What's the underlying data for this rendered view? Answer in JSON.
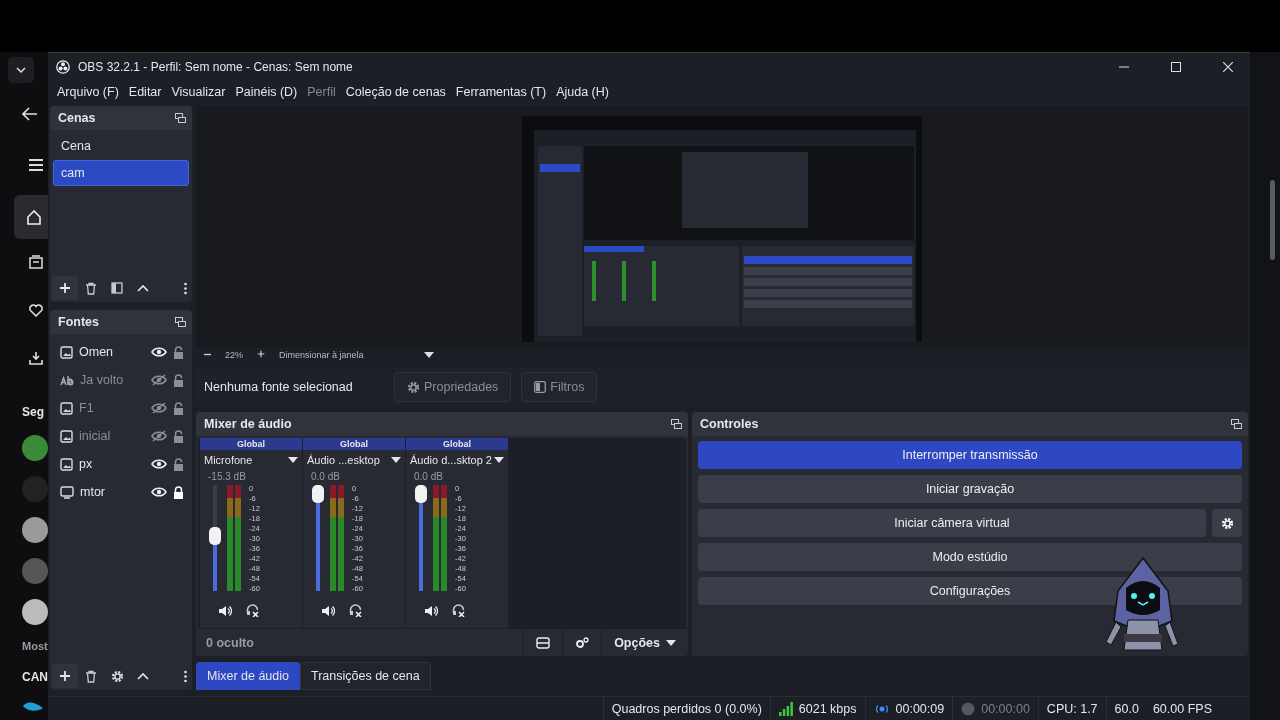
{
  "browser_sidebar": {
    "section_heading": "Seg",
    "more_link": "Most",
    "channel_heading": "CAN"
  },
  "window": {
    "title": "OBS 32.2.1 - Perfil: Sem nome - Cenas: Sem nome"
  },
  "menu": [
    {
      "label": "Arquivo (F)",
      "disabled": false
    },
    {
      "label": "Editar",
      "disabled": false
    },
    {
      "label": "Visualizar",
      "disabled": false
    },
    {
      "label": "Painéis (D)",
      "disabled": false
    },
    {
      "label": "Perfil",
      "disabled": true
    },
    {
      "label": "Coleção de cenas",
      "disabled": false
    },
    {
      "label": "Ferramentas (T)",
      "disabled": false
    },
    {
      "label": "Ajuda (H)",
      "disabled": false
    }
  ],
  "scenes": {
    "title": "Cenas",
    "items": [
      {
        "label": "Cena",
        "selected": false
      },
      {
        "label": "cam",
        "selected": true
      }
    ]
  },
  "sources": {
    "title": "Fontes",
    "items": [
      {
        "kind": "image",
        "label": "Omen",
        "visible": true,
        "locked": false
      },
      {
        "kind": "text",
        "label": "Ja volto",
        "visible": false,
        "locked": false
      },
      {
        "kind": "image",
        "label": "F1",
        "visible": false,
        "locked": false
      },
      {
        "kind": "image",
        "label": "inicial",
        "visible": false,
        "locked": false
      },
      {
        "kind": "image",
        "label": "px",
        "visible": true,
        "locked": false
      },
      {
        "kind": "display",
        "label": "mtor",
        "visible": true,
        "locked": true
      }
    ]
  },
  "preview": {
    "zoom": "22%",
    "scale_mode": "Dimensionar à janela"
  },
  "source_bar": {
    "status": "Nenhuma fonte selecionad",
    "buttons": [
      {
        "kind": "properties",
        "label": "Propriedades",
        "disabled": true
      },
      {
        "kind": "filters",
        "label": "Filtros",
        "disabled": true
      }
    ]
  },
  "mixer": {
    "title": "Mixer de áudio",
    "channels": [
      {
        "tag": "Global",
        "name": "Microfone",
        "reading": "-15.3 dB",
        "level": 0.52,
        "scale": [
          "0",
          "-6",
          "-12",
          "-18",
          "-24",
          "-30",
          "-36",
          "-42",
          "-48",
          "-54",
          "-60"
        ]
      },
      {
        "tag": "Global",
        "name": "Áudio ...esktop",
        "reading": "0.0 dB",
        "level": 1,
        "scale": [
          "0",
          "-6",
          "-12",
          "-18",
          "-24",
          "-30",
          "-36",
          "-42",
          "-48",
          "-54",
          "-60"
        ]
      },
      {
        "tag": "Global",
        "name": "Áudio d...sktop 2",
        "reading": "0.0 dB",
        "level": 1,
        "scale": [
          "0",
          "-6",
          "-12",
          "-18",
          "-24",
          "-30",
          "-36",
          "-42",
          "-48",
          "-54",
          "-60"
        ]
      }
    ],
    "hidden_count": "0 oculto",
    "options": "Opções"
  },
  "controls": {
    "title": "Controles",
    "buttons": [
      {
        "label": "Interromper transmissão",
        "active": true,
        "settings": false
      },
      {
        "label": "Iniciar gravação",
        "active": false,
        "settings": false
      },
      {
        "label": "Iniciar câmera virtual",
        "active": false,
        "settings": true
      },
      {
        "label": "Modo estúdio",
        "active": false,
        "settings": false
      },
      {
        "label": "Configurações",
        "active": false,
        "settings": false
      }
    ]
  },
  "dock_tabs": [
    {
      "label": "Mixer de áudio",
      "selected": true
    },
    {
      "label": "Transições de cena",
      "selected": false
    }
  ],
  "status_bar": {
    "dropped": "Quadros perdidos 0 (0.0%)",
    "bitrate": "6021 kbps",
    "stream": {
      "time": "00:00:09",
      "active": true
    },
    "recording": {
      "time": "00:00:00",
      "active": false
    },
    "cpu": "CPU: 1.7",
    "fps": [
      "60.0",
      "60.00 FPS"
    ]
  }
}
